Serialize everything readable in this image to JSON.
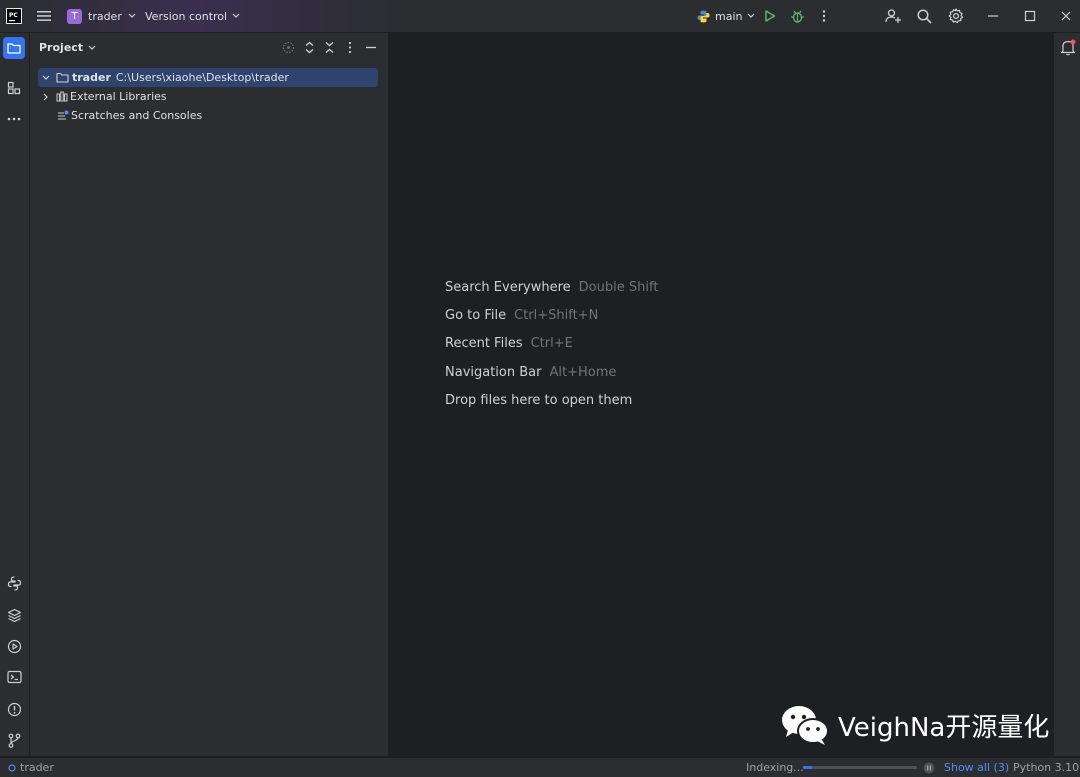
{
  "titlebar": {
    "project_badge": "T",
    "project_name": "trader",
    "vcs_label": "Version control",
    "run_config": "main"
  },
  "project_panel": {
    "title": "Project",
    "tree": [
      {
        "name": "trader",
        "path": "C:\\Users\\xiaohe\\Desktop\\trader"
      },
      {
        "name": "External Libraries"
      },
      {
        "name": "Scratches and Consoles"
      }
    ]
  },
  "editor": {
    "hints": [
      {
        "label": "Search Everywhere",
        "shortcut": "Double Shift"
      },
      {
        "label": "Go to File",
        "shortcut": "Ctrl+Shift+N"
      },
      {
        "label": "Recent Files",
        "shortcut": "Ctrl+E"
      },
      {
        "label": "Navigation Bar",
        "shortcut": "Alt+Home"
      },
      {
        "label": "Drop files here to open them",
        "shortcut": ""
      }
    ]
  },
  "watermark": {
    "text": "VeighNa开源量化"
  },
  "statusbar": {
    "project": "trader",
    "indexing": "Indexing...",
    "indexing_progress": 0.08,
    "show_all": "Show all (3)",
    "interpreter": "Python 3.10"
  },
  "colors": {
    "accent": "#3574f0",
    "selection": "#2e436e",
    "run_green": "#5fb865"
  }
}
